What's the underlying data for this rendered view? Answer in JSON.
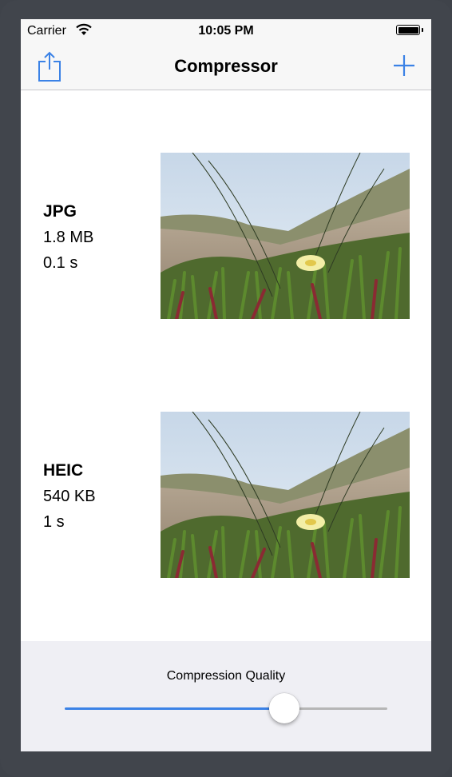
{
  "status_bar": {
    "carrier": "Carrier",
    "time": "10:05 PM"
  },
  "nav": {
    "title": "Compressor",
    "left_icon": "share-icon",
    "right_icon": "add-icon"
  },
  "results": [
    {
      "format": "JPG",
      "size": "1.8 MB",
      "time": "0.1 s"
    },
    {
      "format": "HEIC",
      "size": "540 KB",
      "time": "1 s"
    }
  ],
  "control": {
    "label": "Compression Quality",
    "value": 0.7
  },
  "colors": {
    "accent": "#3b82e6",
    "panel": "#efeff4",
    "bar": "#f7f7f7"
  }
}
